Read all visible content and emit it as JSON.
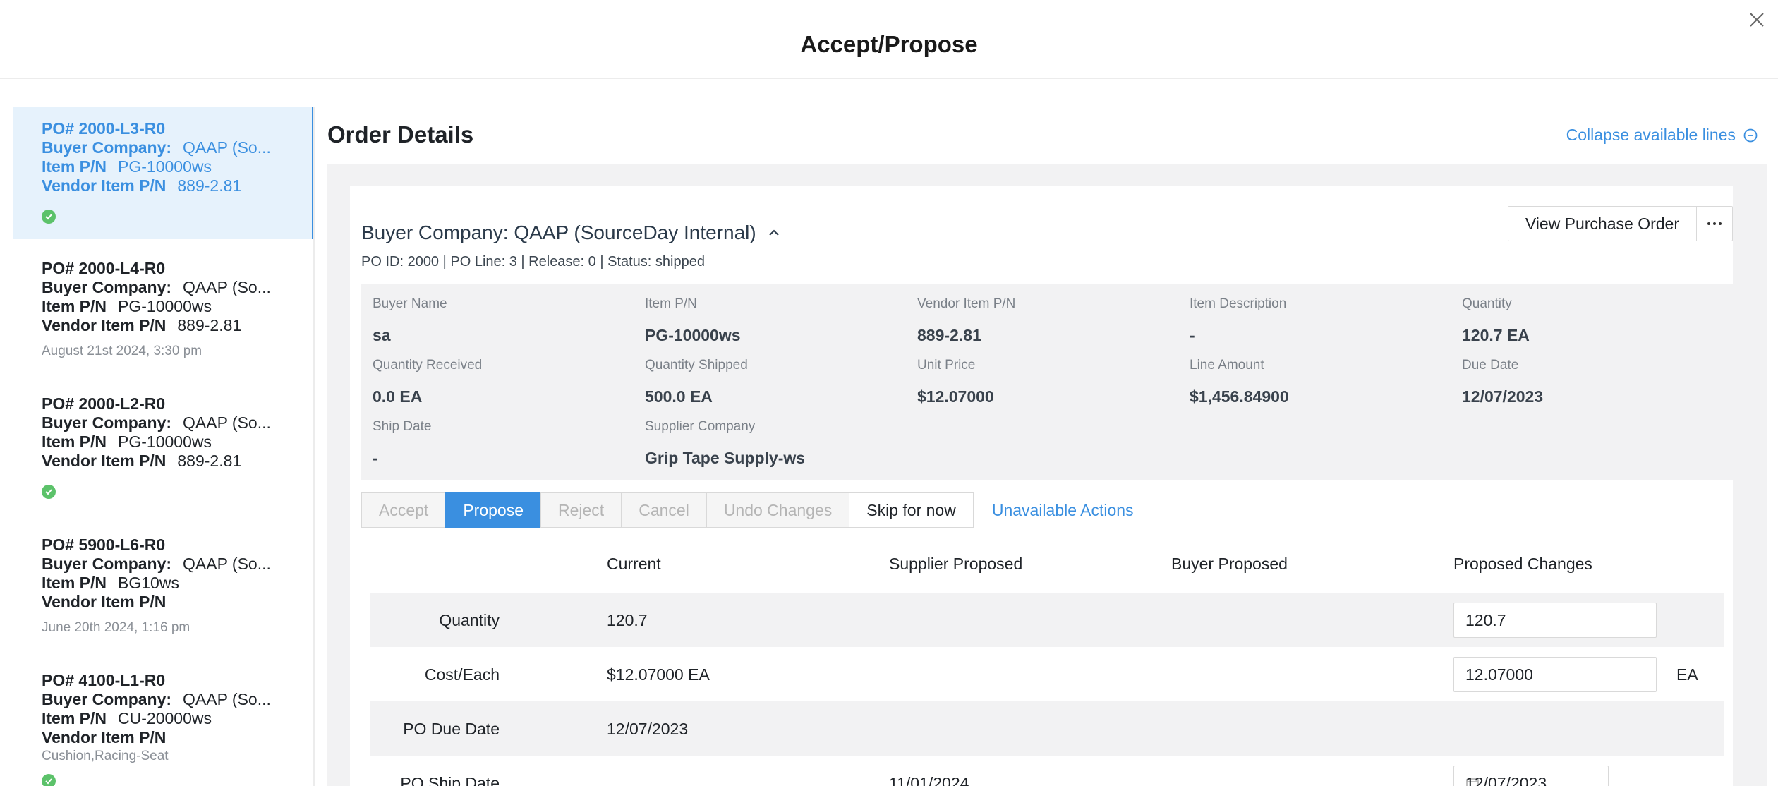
{
  "modal": {
    "title": "Accept/Propose"
  },
  "sidebar": {
    "items": [
      {
        "title": "PO# 2000-L3-R0",
        "buyer_label": "Buyer Company:",
        "buyer_value": "QAAP (So...",
        "item_label": "Item P/N",
        "item_value": "PG-10000ws",
        "vendor_label": "Vendor Item P/N",
        "vendor_value": "889-2.81",
        "meta": "",
        "status": "check"
      },
      {
        "title": "PO# 2000-L4-R0",
        "buyer_label": "Buyer Company:",
        "buyer_value": "QAAP (So...",
        "item_label": "Item P/N",
        "item_value": "PG-10000ws",
        "vendor_label": "Vendor Item P/N",
        "vendor_value": "889-2.81",
        "meta": "August 21st 2024, 3:30 pm",
        "status": ""
      },
      {
        "title": "PO# 2000-L2-R0",
        "buyer_label": "Buyer Company:",
        "buyer_value": "QAAP (So...",
        "item_label": "Item P/N",
        "item_value": "PG-10000ws",
        "vendor_label": "Vendor Item P/N",
        "vendor_value": "889-2.81",
        "meta": "",
        "status": "check"
      },
      {
        "title": "PO# 5900-L6-R0",
        "buyer_label": "Buyer Company:",
        "buyer_value": "QAAP (So...",
        "item_label": "Item P/N",
        "item_value": "BG10ws",
        "vendor_label": "Vendor Item P/N",
        "vendor_value": "",
        "meta": "June 20th 2024, 1:16 pm",
        "status": ""
      },
      {
        "title": "PO# 4100-L1-R0",
        "buyer_label": "Buyer Company:",
        "buyer_value": "QAAP (So...",
        "item_label": "Item P/N",
        "item_value": "CU-20000ws",
        "vendor_label": "Vendor Item P/N",
        "vendor_value": "",
        "meta": "Cushion,Racing-Seat",
        "status": "check"
      }
    ]
  },
  "main": {
    "title": "Order Details",
    "collapse_label": "Collapse available lines",
    "buyer_company": "Buyer Company: QAAP (SourceDay Internal)",
    "po_summary": "PO ID: 2000 | PO Line: 3 | Release: 0 | Status: shipped",
    "view_po_label": "View Purchase Order",
    "more_label": "···",
    "details": [
      {
        "label": "Buyer Name",
        "value": "sa"
      },
      {
        "label": "Item P/N",
        "value": "PG-10000ws"
      },
      {
        "label": "Vendor Item P/N",
        "value": "889-2.81"
      },
      {
        "label": "Item Description",
        "value": "-"
      },
      {
        "label": "Quantity",
        "value": "120.7 EA"
      },
      {
        "label": "Quantity Received",
        "value": "0.0 EA"
      },
      {
        "label": "Quantity Shipped",
        "value": "500.0 EA"
      },
      {
        "label": "Unit Price",
        "value": "$12.07000"
      },
      {
        "label": "Line Amount",
        "value": "$1,456.84900"
      },
      {
        "label": "Due Date",
        "value": "12/07/2023"
      },
      {
        "label": "Ship Date",
        "value": "-"
      },
      {
        "label": "Supplier Company",
        "value": "Grip Tape Supply-ws"
      }
    ],
    "actions": {
      "accept": "Accept",
      "propose": "Propose",
      "reject": "Reject",
      "cancel": "Cancel",
      "undo": "Undo Changes",
      "skip": "Skip for now",
      "unavailable": "Unavailable Actions"
    },
    "table": {
      "headers": {
        "current": "Current",
        "supplier": "Supplier Proposed",
        "buyer": "Buyer Proposed",
        "proposed": "Proposed Changes"
      },
      "rows": [
        {
          "label": "Quantity",
          "current": "120.7",
          "supplier": "",
          "buyer": "",
          "proposed": "120.7",
          "unit": ""
        },
        {
          "label": "Cost/Each",
          "current": "$12.07000 EA",
          "supplier": "",
          "buyer": "",
          "proposed": "12.07000",
          "unit": "EA"
        },
        {
          "label": "PO Due Date",
          "current": "12/07/2023",
          "supplier": "",
          "buyer": "",
          "proposed": "",
          "unit": ""
        },
        {
          "label": "PO Ship Date",
          "current": "",
          "supplier": "11/01/2024",
          "buyer": "",
          "proposed": "12/07/2023",
          "unit": ""
        }
      ]
    }
  },
  "colors": {
    "accent": "#3a8fe0",
    "success": "#5cc26a",
    "panel": "#f2f2f3"
  }
}
